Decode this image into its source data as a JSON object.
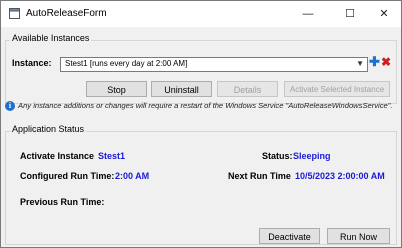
{
  "window": {
    "title": "AutoReleaseForm",
    "minimize_glyph": "—",
    "maximize_glyph": "☐",
    "close_glyph": "✕"
  },
  "instances_group": {
    "label": "Available Instances",
    "instance_label": "Instance:",
    "selected_instance": "Stest1 [runs every day at 2:00 AM]",
    "add_icon": "plus-icon",
    "delete_icon": "x-icon",
    "buttons": {
      "stop": "Stop",
      "uninstall": "Uninstall",
      "details": "Details",
      "activate_selected": "Activate Selected Instance"
    }
  },
  "notice": "Any instance additions or changes will require a restart of the Windows Service \"AutoReleaseWindowsService\".",
  "status_group": {
    "label": "Application Status",
    "active_instance_label": "Activate Instance",
    "active_instance_value": "Stest1",
    "status_label": "Status:",
    "status_value": "Sleeping",
    "configured_run_time_label": "Configured Run Time:",
    "configured_run_time_value": "2:00 AM",
    "next_run_time_label": "Next Run Time",
    "next_run_time_value": "10/5/2023 2:00:00 AM",
    "previous_run_time_label": "Previous Run Time:",
    "buttons": {
      "deactivate": "Deactivate",
      "run_now": "Run Now"
    }
  },
  "colors": {
    "value_blue": "#1a1ad6",
    "add_blue": "#1e6fd0",
    "delete_red": "#d01e1e"
  }
}
